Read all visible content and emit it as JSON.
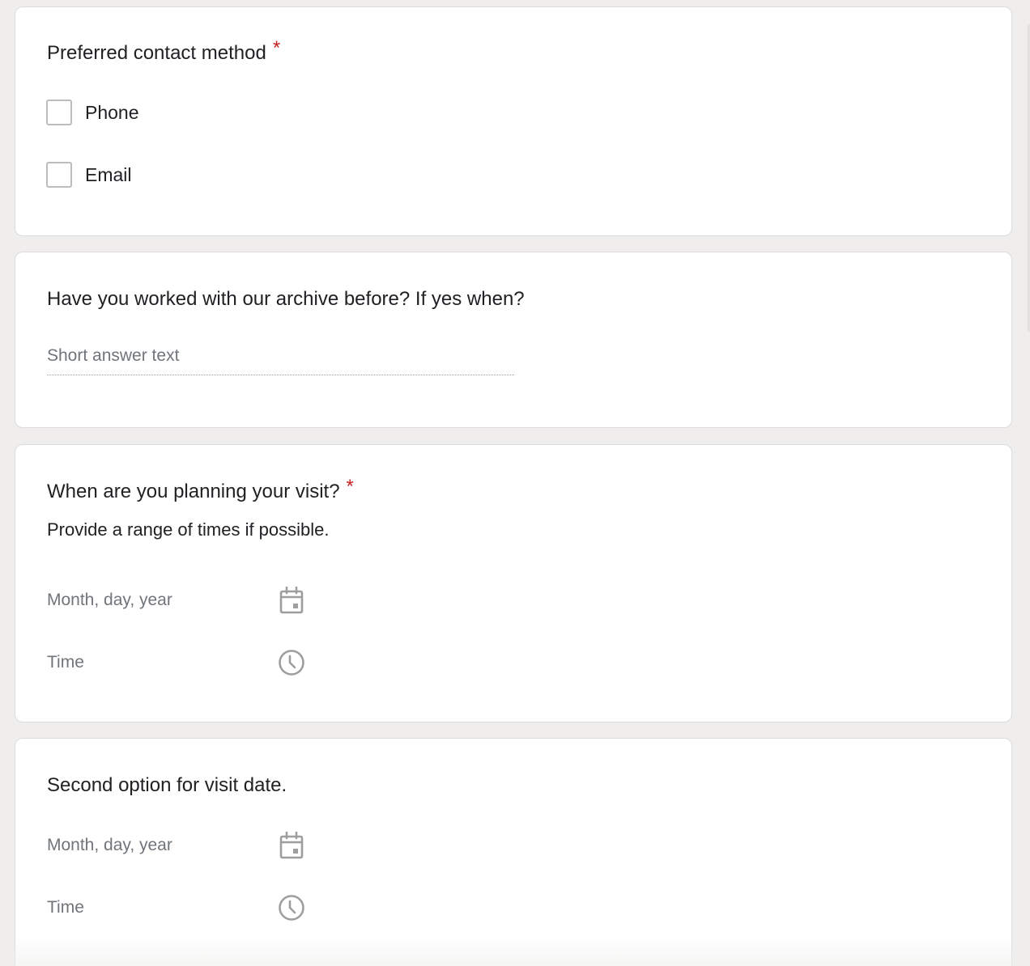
{
  "questions": {
    "contact": {
      "title": "Preferred contact method",
      "required_mark": "*",
      "options": [
        {
          "label": "Phone",
          "checked": false
        },
        {
          "label": "Email",
          "checked": false
        }
      ]
    },
    "archive": {
      "title": "Have you worked with our archive before? If yes when?",
      "placeholder": "Short answer text"
    },
    "visit": {
      "title": "When are you planning your visit?",
      "required_mark": "*",
      "description": "Provide a range of times if possible.",
      "date_placeholder": "Month, day, year",
      "time_placeholder": "Time"
    },
    "second_visit": {
      "title": "Second option for visit date.",
      "date_placeholder": "Month, day, year",
      "time_placeholder": "Time"
    }
  },
  "icons": {
    "calendar": "calendar-icon",
    "clock": "clock-icon"
  },
  "colors": {
    "background": "#efeeec",
    "card": "#ffffff",
    "required": "#c5221f",
    "placeholder": "#70757a",
    "checkbox_border": "#bdbdbd",
    "icon": "#9e9e9e"
  }
}
